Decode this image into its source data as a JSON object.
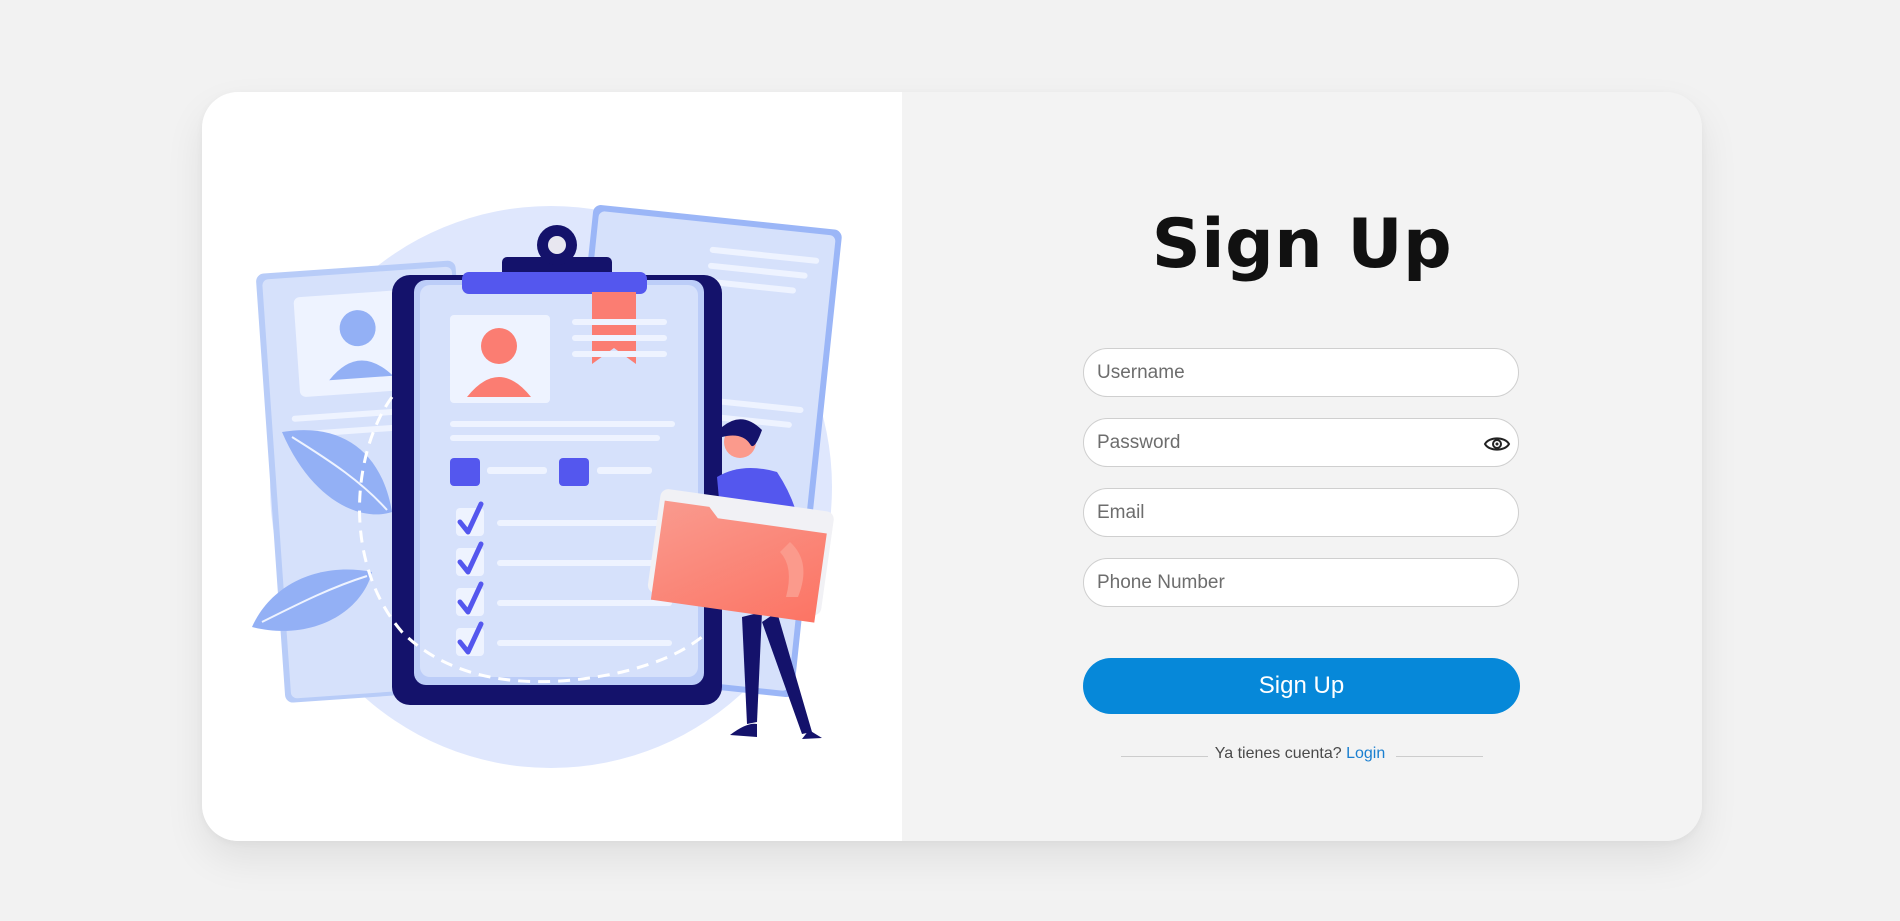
{
  "signup": {
    "title": "Sign Up",
    "fields": {
      "username_placeholder": "Username",
      "password_placeholder": "Password",
      "email_placeholder": "Email",
      "phone_placeholder": "Phone Number"
    },
    "password_toggle_icon": "eye-icon",
    "submit_label": "Sign Up",
    "login_prompt": "Ya tienes cuenta?",
    "login_link": "Login"
  },
  "illustration": {
    "description_icon": "resume-clipboard-illustration"
  },
  "colors": {
    "page_background": "#f2f2f2",
    "form_panel_background": "#f3f3f3",
    "illustration_panel_background": "#ffffff",
    "primary_button": "#0688d9",
    "link": "#1a7fd0",
    "title_text": "#111111",
    "illustration_accent_blue": "#5457ee",
    "illustration_navy": "#14126b",
    "illustration_coral": "#fb7d72",
    "illustration_light_blue": "#d6e1fb"
  }
}
